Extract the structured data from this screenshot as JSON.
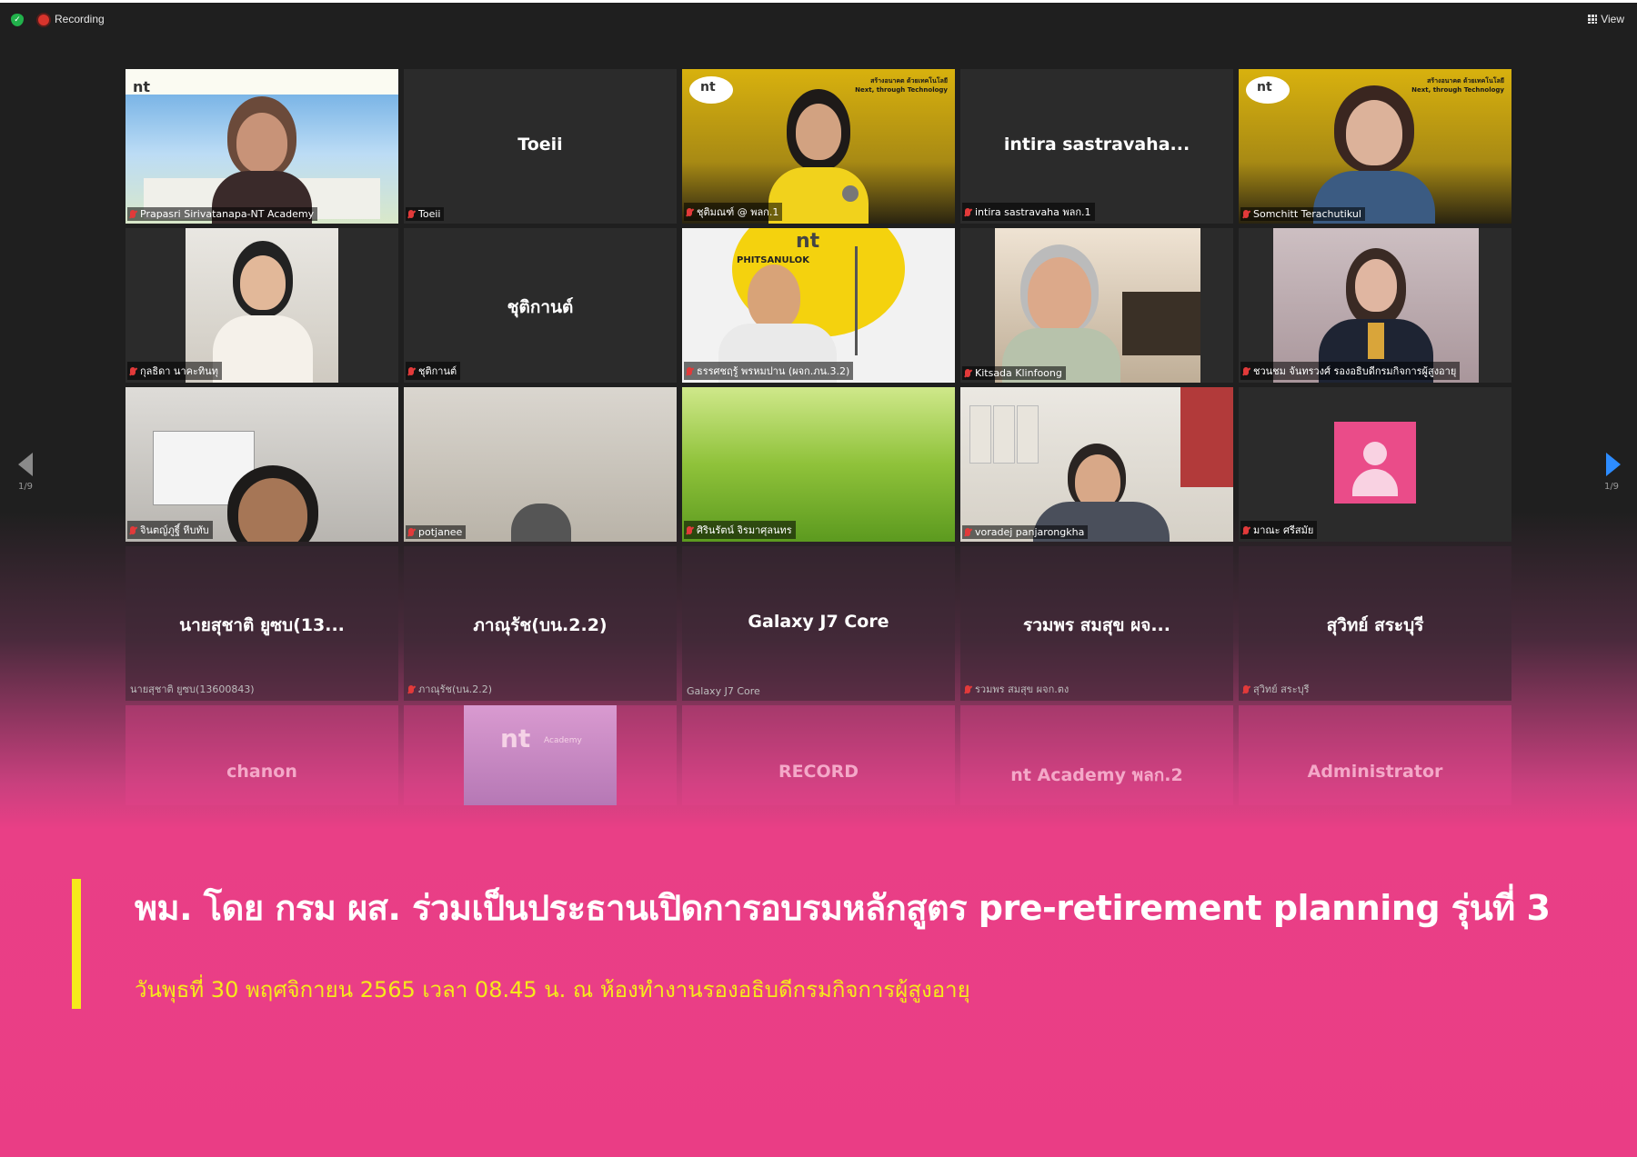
{
  "toolbar": {
    "recording_label": "Recording",
    "view_label": "View"
  },
  "pagination": {
    "left_page": "1/9",
    "right_page": "1/9"
  },
  "participants": [
    {
      "id": "p1",
      "label": "Prapasri  Sirivatanapa-NT Academy",
      "name": "",
      "video": true,
      "muted": true
    },
    {
      "id": "p2",
      "label": "Toeii",
      "name": "Toeii",
      "video": false,
      "muted": true
    },
    {
      "id": "p3",
      "label": "ชุติมณฑ์ @ พลก.1",
      "name": "",
      "video": true,
      "muted": true
    },
    {
      "id": "p4",
      "label": "intira sastravaha พลก.1",
      "name": "intira sastravaha...",
      "video": false,
      "muted": true
    },
    {
      "id": "p5",
      "label": "Somchitt Terachutikul",
      "name": "",
      "video": true,
      "muted": true
    },
    {
      "id": "p6",
      "label": "กุลธิดา นาคะทินทุ",
      "name": "",
      "video": true,
      "muted": true
    },
    {
      "id": "p7",
      "label": "ชุติกานต์",
      "name": "ชุติกานต์",
      "video": false,
      "muted": true
    },
    {
      "id": "p8",
      "label": "ธรรศชฤรู้ พรหมปาน (ผจก.ภน.3.2)",
      "name": "",
      "video": true,
      "muted": true
    },
    {
      "id": "p9",
      "label": "Kitsada Klinfoong",
      "name": "",
      "video": true,
      "muted": true
    },
    {
      "id": "p10",
      "label": "ชวนชม จันทรวงศ์ รองอธิบดีกรมกิจการผู้สูงอายุ",
      "name": "",
      "video": true,
      "muted": true
    },
    {
      "id": "p11",
      "label": "จินตญ์ภูฐี์ หีบทับ",
      "name": "",
      "video": true,
      "muted": true
    },
    {
      "id": "p12",
      "label": "potjanee",
      "name": "",
      "video": true,
      "muted": true
    },
    {
      "id": "p13",
      "label": "ศิรินรัตน์ จิรมาศุลนทร",
      "name": "",
      "video": true,
      "muted": true
    },
    {
      "id": "p14",
      "label": "voradej panjarongkha",
      "name": "",
      "video": true,
      "muted": true
    },
    {
      "id": "p15",
      "label": "มาณะ ศรีสมัย",
      "name": "",
      "video": false,
      "muted": true,
      "avatar": true
    },
    {
      "id": "p16",
      "label": "นายสุชาติ ยูซบ(13600843)",
      "name": "นายสุชาติ ยูซบ(13...",
      "video": false,
      "muted": false
    },
    {
      "id": "p17",
      "label": "ภาณุรัช(บน.2.2)",
      "name": "ภาณุรัช(บน.2.2)",
      "video": false,
      "muted": true
    },
    {
      "id": "p18",
      "label": "Galaxy J7 Core",
      "name": "Galaxy J7 Core",
      "video": false,
      "muted": false
    },
    {
      "id": "p19",
      "label": "รวมพร สมสุข ผจก.ตง",
      "name": "รวมพร สมสุข ผจ...",
      "video": false,
      "muted": true
    },
    {
      "id": "p20",
      "label": "สุวิทย์ สระบุรี",
      "name": "สุวิทย์ สระบุรี",
      "video": false,
      "muted": true
    },
    {
      "id": "p21",
      "label": "",
      "name": "chanon",
      "video": false,
      "muted": false
    },
    {
      "id": "p22",
      "label": "",
      "name": "",
      "video": true,
      "muted": false
    },
    {
      "id": "p23",
      "label": "",
      "name": "RECORD",
      "video": false,
      "muted": false
    },
    {
      "id": "p24",
      "label": "",
      "name": "nt Academy พลก.2",
      "video": false,
      "muted": false
    },
    {
      "id": "p25",
      "label": "",
      "name": "Administrator",
      "video": false,
      "muted": false
    }
  ],
  "video_texts": {
    "p1_logo": "nt",
    "p3_logo": "nt",
    "p3_tagline": "สร้างอนาคต ด้วยเทคโนโลยี\nNext, through Technology",
    "p5_logo": "nt",
    "p5_tagline": "สร้างอนาคต ด้วยเทคโนโลยี\nNext, through Technology",
    "p8_logo": "nt",
    "p8_place": "PHITSANULOK",
    "p22_logo": "nt",
    "p22_sub": "Academy"
  },
  "banner": {
    "headline": "พม. โดย กรม ผส. ร่วมเป็นประธานเปิดการอบรมหลักสูตร pre-retirement planning รุ่นที่ 3",
    "subline": "วันพุธที่ 30 พฤศจิกายน 2565 เวลา 08.45 น. ณ ห้องทำงานรองอธิบดีกรมกิจการผู้สูงอายุ",
    "bar_color": "#f6ea1b",
    "bg_color": "#ea3d85"
  },
  "colors": {
    "active_speaker": "#b5e72a",
    "mic_muted": "#e23a3a",
    "nav_active": "#2d8cff"
  }
}
